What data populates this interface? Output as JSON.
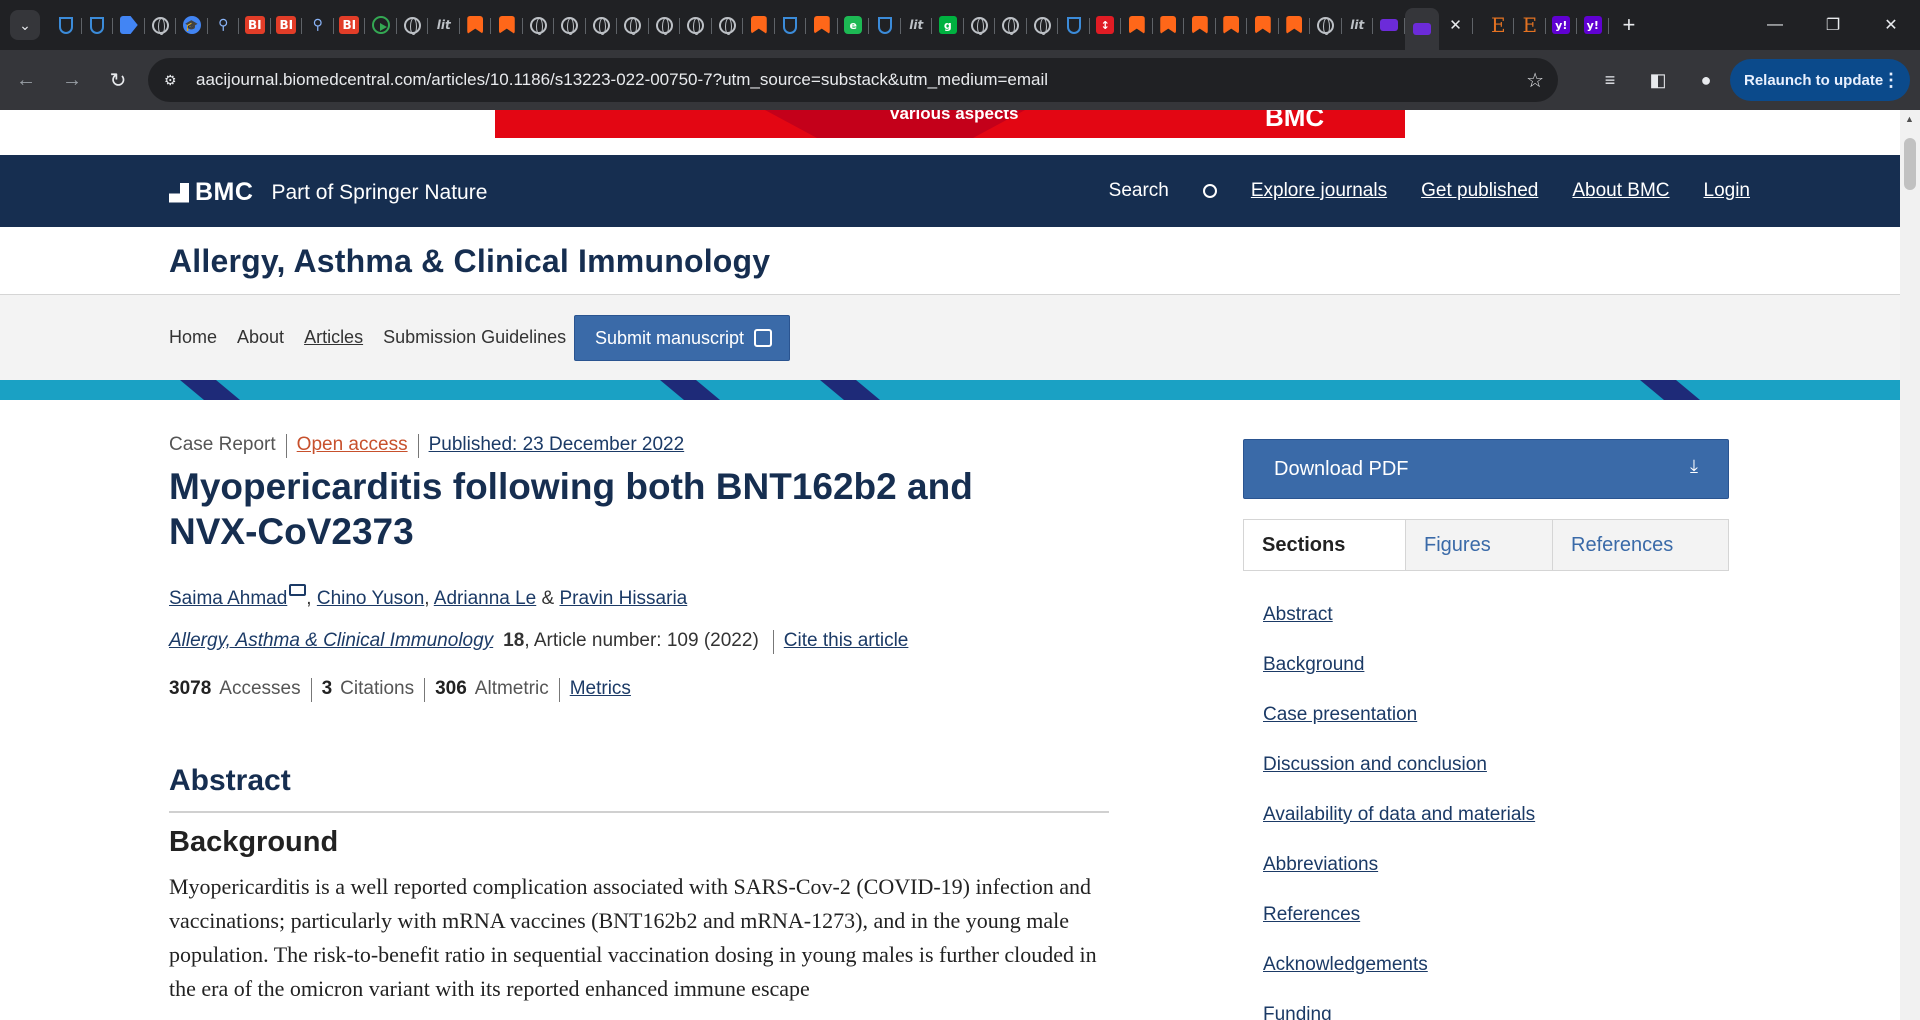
{
  "browser": {
    "active_tab_close": "✕",
    "new_tab": "+",
    "url": "aacijournal.biomedcentral.com/articles/10.1186/s13223-022-00750-7?utm_source=substack&utm_medium=email",
    "relaunch_label": "Relaunch to update",
    "tab_icons": [
      "shield",
      "shield",
      "arrow",
      "globe",
      "cap",
      "search",
      "bi",
      "bi",
      "search",
      "bi",
      "play",
      "globe",
      "literature",
      "bookmark",
      "bookmark",
      "globe",
      "globe",
      "globe",
      "globe",
      "globe",
      "globe",
      "globe",
      "bookmark",
      "shield",
      "bookmark",
      "greenc",
      "shield",
      "literature",
      "g",
      "globe",
      "globe",
      "globe",
      "shield",
      "red",
      "bookmark",
      "bookmark",
      "bookmark",
      "bookmark",
      "bookmark",
      "bookmark",
      "globe",
      "literature",
      "purple"
    ],
    "tab_icons_right": [
      "E",
      "E",
      "y",
      "y"
    ],
    "colors": {
      "tabstrip": "#202124",
      "toolbar": "#35363a",
      "relaunch": "#0b4a8b"
    }
  },
  "ad": {
    "text": "various aspects",
    "logo": "BMC"
  },
  "header": {
    "brand": "BMC",
    "part_of": "Part of Springer Nature",
    "nav": {
      "search": "Search",
      "explore": "Explore journals",
      "get_published": "Get published",
      "about": "About BMC",
      "login": "Login"
    },
    "color": "#162e50"
  },
  "journal": {
    "title": "Allergy, Asthma & Clinical Immunology"
  },
  "subnav": {
    "home": "Home",
    "about": "About",
    "articles": "Articles",
    "guidelines": "Submission Guidelines",
    "submit": "Submit manuscript"
  },
  "article": {
    "type": "Case Report",
    "open_access": "Open access",
    "published": "Published: 23 December 2022",
    "title": "Myopericarditis following both BNT162b2 and NVX-CoV2373",
    "authors": {
      "a1": "Saima Ahmad",
      "a2": "Chino Yuson",
      "a3": "Adrianna Le",
      "a4": "Pravin Hissaria",
      "comma": ", ",
      "amp": " & "
    },
    "citation": {
      "journal": "Allergy, Asthma & Clinical Immunology",
      "volume": "18",
      "number": ", Article number: 109 (2022)",
      "cite": "Cite this article"
    },
    "metrics": {
      "accesses_n": "3078",
      "accesses": "Accesses",
      "citations_n": "3",
      "citations": "Citations",
      "altmetric_n": "306",
      "altmetric": "Altmetric",
      "metrics_link": "Metrics"
    },
    "abstract_heading": "Abstract",
    "background_heading": "Background",
    "background_text": "Myopericarditis is a well reported complication associated with SARS-Cov-2 (COVID-19) infection and vaccinations; particularly with mRNA vaccines (BNT162b2 and mRNA-1273), and in the young male population. The risk-to-benefit ratio in sequential vaccination dosing in young males is further clouded in the era of the omicron variant with its reported enhanced immune escape"
  },
  "sidebar": {
    "download": "Download PDF",
    "tabs": [
      "Sections",
      "Figures",
      "References"
    ],
    "toc": [
      "Abstract",
      "Background",
      "Case presentation",
      "Discussion and conclusion",
      "Availability of data and materials",
      "Abbreviations",
      "References",
      "Acknowledgements",
      "Funding"
    ]
  }
}
